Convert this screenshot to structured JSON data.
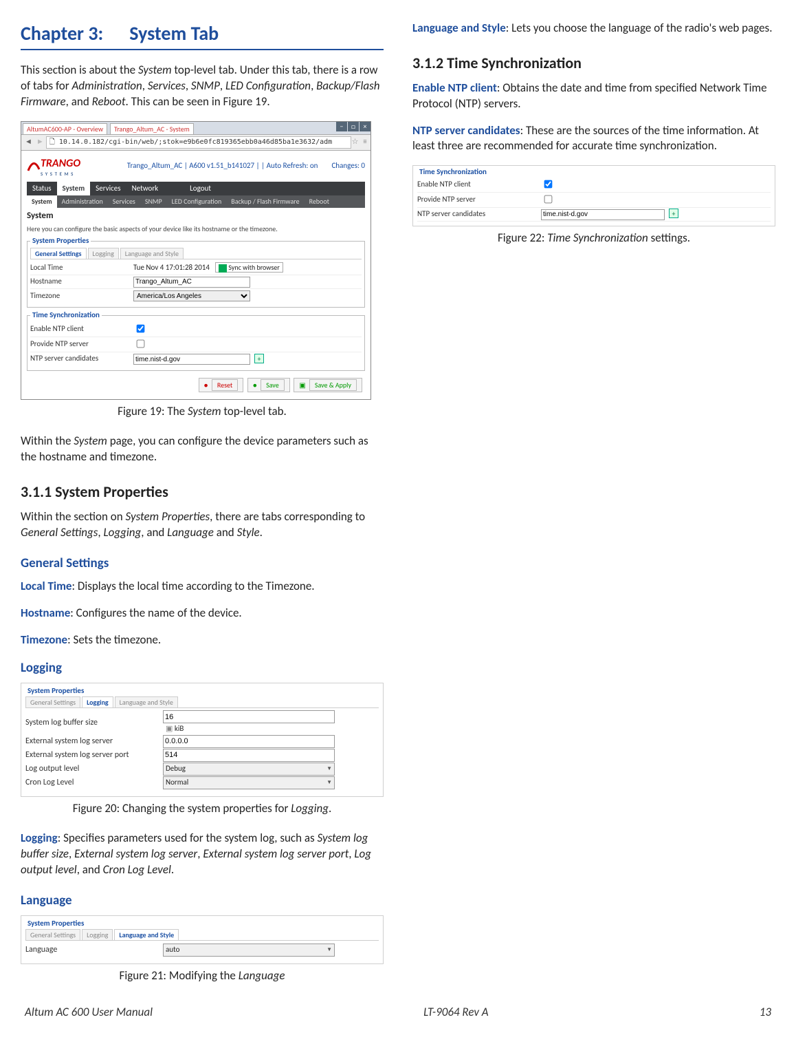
{
  "chapter": {
    "label": "Chapter 3:",
    "title": "System Tab"
  },
  "p1a": "This section is about the ",
  "p1b": "System",
  "p1c": " top-level tab. Under this tab, there is a row of tabs for ",
  "p1d": "Administration",
  "p1e": ", ",
  "p1f": "Services",
  "p1g": ", ",
  "p1h": "SNMP",
  "p1i": ", ",
  "p1j": "LED Configuration",
  "p1k": ", ",
  "p1l": "Backup/Flash Firmware",
  "p1m": ", and ",
  "p1n": "Reboot",
  "p1o": ". This can be seen in Figure 19.",
  "fig19": {
    "browser_tabs": [
      "AltumAC600-AP - Overview",
      "Trango_Altum_AC - System"
    ],
    "url": "10.14.0.182/cgi-bin/web/;stok=e9b6e0fc819365ebb0a46d85ba1e3632/adm",
    "breadcrumb": "Trango_Altum_AC  |  A600 v1.51_b141027  |  |  Auto Refresh: on",
    "changes": "Changes: 0",
    "nav": [
      "Status",
      "System",
      "Services",
      "Network"
    ],
    "nav_logout": "Logout",
    "subnav": [
      "System",
      "Administration",
      "Services",
      "SNMP",
      "LED Configuration",
      "Backup / Flash Firmware",
      "Reboot"
    ],
    "page_title": "System",
    "page_desc": "Here you can configure the basic aspects of your device like its hostname or the timezone.",
    "props_legend": "System Properties",
    "tabs": [
      "General Settings",
      "Logging",
      "Language and Style"
    ],
    "time_label": "Local Time",
    "time_value": "Tue Nov 4 17:01:28 2014",
    "sync_btn": "Sync with browser",
    "host_label": "Hostname",
    "host_value": "Trango_Altum_AC",
    "tz_label": "Timezone",
    "tz_value": "America/Los Angeles",
    "sync_legend": "Time Synchronization",
    "ntp_enable": "Enable NTP client",
    "ntp_provide": "Provide NTP server",
    "ntp_cand": "NTP server candidates",
    "ntp_value": "time.nist-d.gov",
    "reset": "Reset",
    "save": "Save",
    "apply": "Save & Apply",
    "caption_a": "Figure 19: The ",
    "caption_b": "System",
    "caption_c": " top-level tab."
  },
  "p2a": "Within the ",
  "p2b": "System",
  "p2c": " page, you can configure the device parameters such as the hostname and timezone.",
  "h_311": "3.1.1  System Properties",
  "p3a": "Within the section on ",
  "p3b": "System Properties",
  "p3c": ", there are tabs corresponding to ",
  "p3d": "General Settings",
  "p3e": ", ",
  "p3f": "Logging",
  "p3g": ", and ",
  "p3h": "Language",
  "p3i": " and ",
  "p3j": "Style",
  "p3k": ".",
  "gs_head": "General Settings",
  "lt_term": "Local Time",
  "lt_txt": ": Displays the local time according to the Timezone.",
  "hn_term": "Hostname",
  "hn_txt": ": Configures the name of the device.",
  "tz_term": "Timezone",
  "tz_txt": ": Sets the timezone.",
  "log_head": "Logging",
  "fig20": {
    "legend": "System Properties",
    "tabs": [
      "General Settings",
      "Logging",
      "Language and Style"
    ],
    "r1": "System log buffer size",
    "v1": "16",
    "kib": "kiB",
    "r2": "External system log server",
    "v2": "0.0.0.0",
    "r3": "External system log server port",
    "v3": "514",
    "r4": "Log output level",
    "v4": "Debug",
    "r5": "Cron Log Level",
    "v5": "Normal",
    "cap_a": "Figure 20: Changing the system properties for ",
    "cap_b": "Logging",
    "cap_c": "."
  },
  "log_term": "Logging",
  "log_txt_a": ": Specifies parameters used for the system log, such as ",
  "log_i1": "System log buffer size",
  "log_i2": "External system log server",
  "log_i3": "External system log server port",
  "log_i4": "Log output level",
  "log_i5": "Cron Log Level",
  "comma": ", ",
  "and": ", and ",
  "period": ".",
  "lang_head": "Language",
  "fig21": {
    "legend": "System Properties",
    "tabs": [
      "General Settings",
      "Logging",
      "Language and Style"
    ],
    "label": "Language",
    "value": "auto",
    "cap_a": "Figure 21: Modifying the ",
    "cap_b": "Language"
  },
  "ls_term": "Language and Style",
  "ls_txt": ": Lets you choose the language of the radio's web pages.",
  "h_312": "3.1.2  Time Synchronization",
  "ntpc_term": "Enable NTP client",
  "ntpc_txt": ": Obtains the date and time from specified Network Time Protocol (NTP) servers.",
  "ntps_term": "NTP server candidates",
  "ntps_txt": ": These are the sources of the time information. At least three are recommended for accurate time synchronization.",
  "fig22": {
    "legend": "Time Synchronization",
    "r1": "Enable NTP client",
    "r2": "Provide NTP server",
    "r3": "NTP server candidates",
    "v3": "time.nist-d.gov",
    "cap_a": "Figure 22: ",
    "cap_b": "Time Synchronization",
    "cap_c": " settings."
  },
  "footer": {
    "left": "Altum AC 600 User Manual",
    "center": "LT-9064 Rev A",
    "right": "13"
  }
}
